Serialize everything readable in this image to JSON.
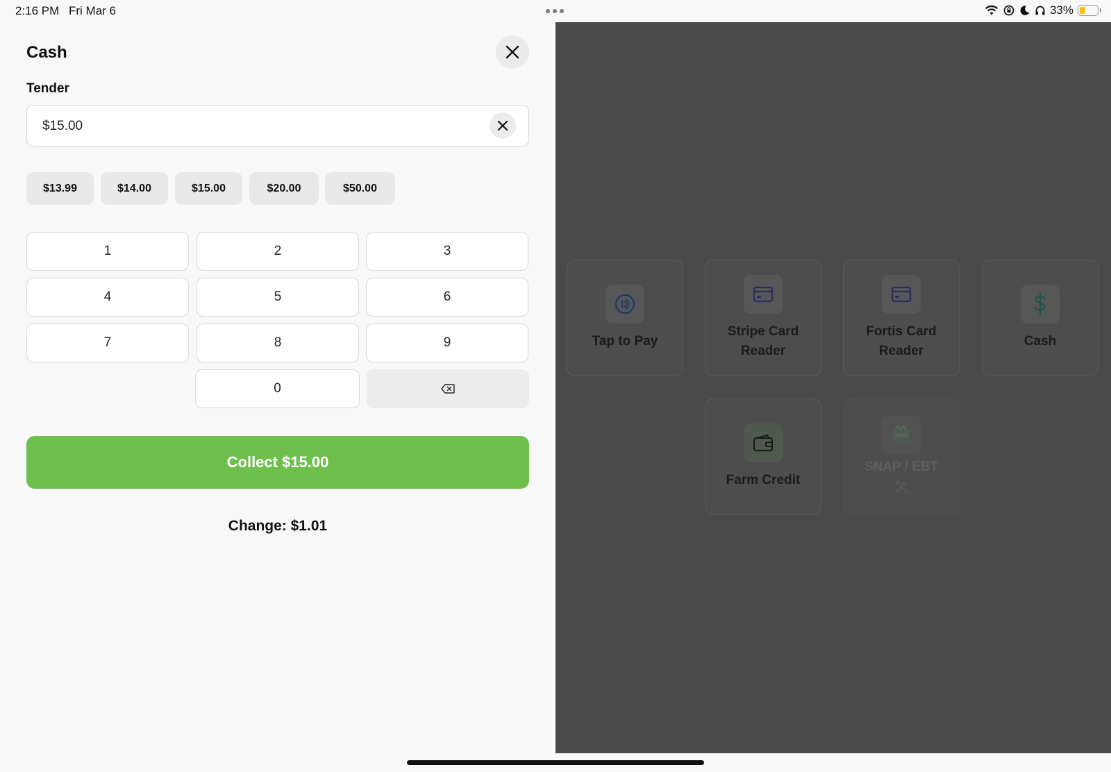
{
  "status_bar": {
    "time": "2:16 PM",
    "date": "Fri Mar 6",
    "battery": "33%"
  },
  "panel": {
    "title": "Cash",
    "tender_label": "Tender",
    "tender_value": "$15.00",
    "quick_amounts": [
      "$13.99",
      "$14.00",
      "$15.00",
      "$20.00",
      "$50.00"
    ],
    "keypad": [
      "1",
      "2",
      "3",
      "4",
      "5",
      "6",
      "7",
      "8",
      "9",
      "0"
    ],
    "collect_label": "Collect $15.00",
    "change_text": "Change: $1.01",
    "collect_color": "#6ebf4b"
  },
  "payment_methods": [
    {
      "label": "Tap to Pay",
      "icon": "contactless-icon"
    },
    {
      "label": "Stripe Card Reader",
      "icon": "card-icon"
    },
    {
      "label": "Fortis Card Reader",
      "icon": "card-icon"
    },
    {
      "label": "Cash",
      "icon": "dollar-icon"
    },
    {
      "label": "Farm Credit",
      "icon": "wallet-icon"
    },
    {
      "label": "SNAP / EBT",
      "icon": "snap-logo-icon",
      "badge_icon": "tools-icon"
    }
  ]
}
